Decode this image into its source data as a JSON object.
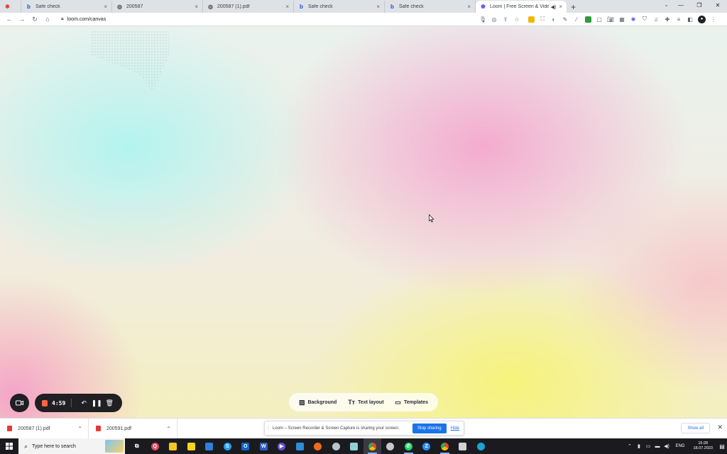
{
  "browser": {
    "tabs": [
      {
        "title": "",
        "favicon": "red-star-icon",
        "close": "×"
      },
      {
        "title": "Safe check",
        "favicon": "b-logo-icon",
        "close": "×"
      },
      {
        "title": "200587",
        "favicon": "globe-icon",
        "close": "×"
      },
      {
        "title": "200587 (1).pdf",
        "favicon": "globe-icon",
        "close": "×"
      },
      {
        "title": "Safe check",
        "favicon": "b-logo-icon",
        "close": "×"
      },
      {
        "title": "Safe check",
        "favicon": "b-logo-icon",
        "close": "×"
      },
      {
        "title": "Loom | Free Screen & Video",
        "favicon": "loom-icon",
        "close": "×",
        "active": true
      }
    ],
    "new_tab": "+",
    "url": "loom.com/canvas"
  },
  "recorder": {
    "timer": "4:59"
  },
  "canvas_options": {
    "background_label": "Background",
    "text_layout_label": "Text layout",
    "templates_label": "Templates"
  },
  "downloads": {
    "items": [
      {
        "name": "200587 (1).pdf"
      },
      {
        "name": "200591.pdf"
      }
    ],
    "share_message": "Loom – Screen Recorder & Screen Capture is sharing your screen.",
    "stop_sharing_label": "Stop sharing",
    "hide_label": "Hide",
    "show_all_label": "Show all"
  },
  "taskbar": {
    "search_placeholder": "Type here to search",
    "language": "ENG",
    "time": "15:28",
    "date": "18.07.2023"
  },
  "colors": {
    "accent_blue": "#1a73e8",
    "record_orange": "#ff623e",
    "recorder_dark": "#1f1f24"
  }
}
